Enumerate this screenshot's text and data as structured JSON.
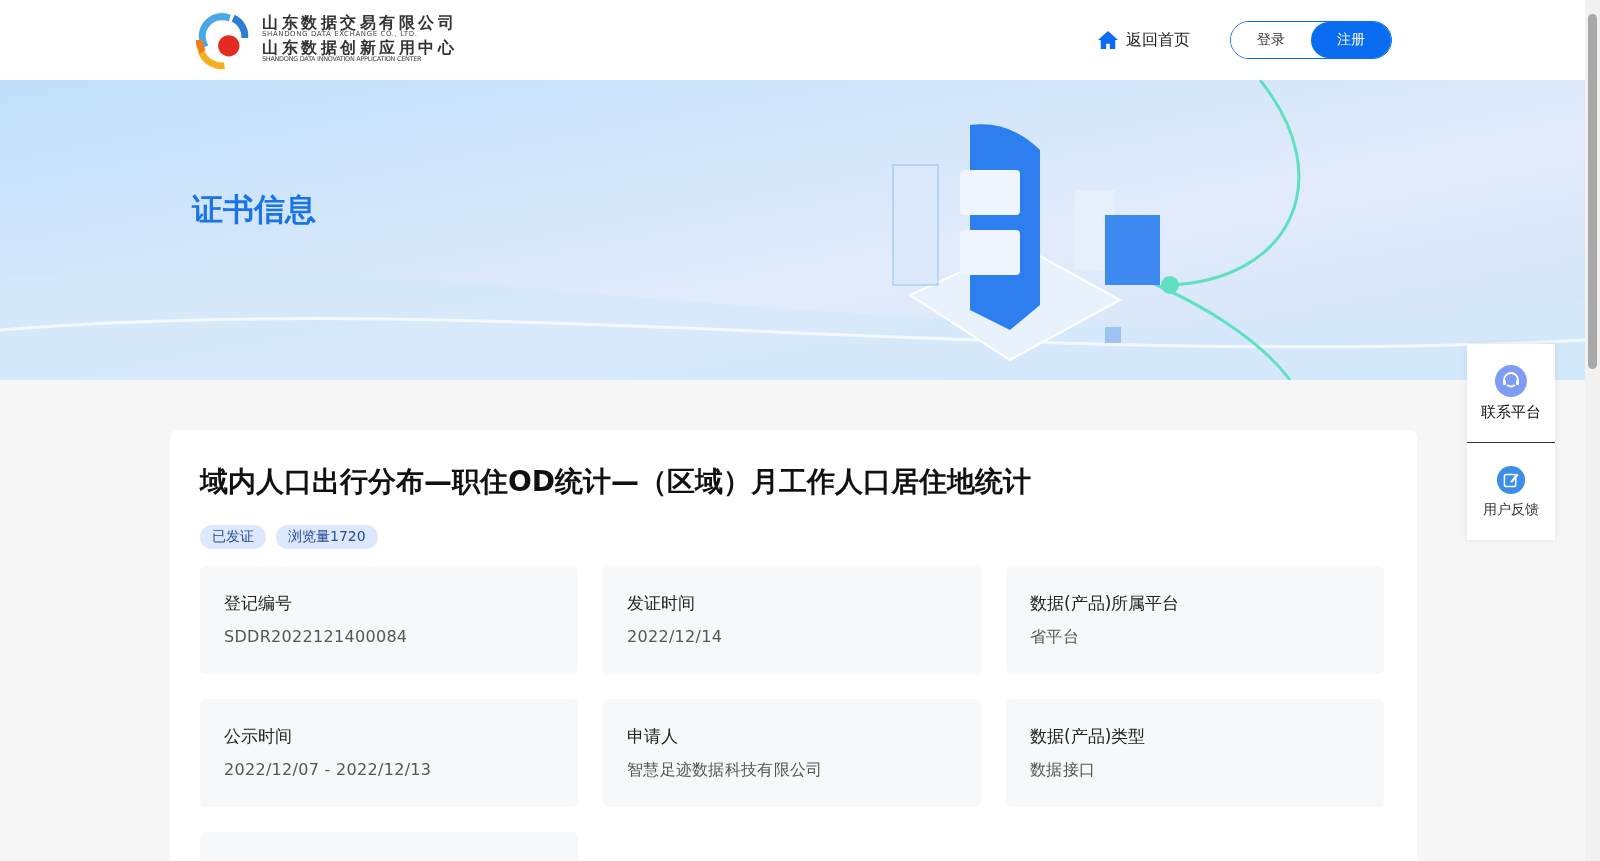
{
  "header": {
    "logo": {
      "company_cn": "山东数据交易有限公司",
      "company_en": "SHANDONG DATA EXCHANGE CO., LTD.",
      "center_cn": "山东数据创新应用中心",
      "center_en": "SHANDONG DATA INNOVATION APPLICATION CENTER"
    },
    "home_link": "返回首页",
    "login": "登录",
    "register": "注册"
  },
  "banner": {
    "title": "证书信息"
  },
  "certificate": {
    "title": "域内人口出行分布—职住OD统计—（区域）月工作人口居住地统计",
    "tags": [
      "已发证",
      "浏览量1720"
    ],
    "fields": [
      {
        "label": "登记编号",
        "value": "SDDR2022121400084"
      },
      {
        "label": "发证时间",
        "value": "2022/12/14"
      },
      {
        "label": "数据(产品)所属平台",
        "value": "省平台"
      },
      {
        "label": "公示时间",
        "value": "2022/12/07 - 2022/12/13"
      },
      {
        "label": "申请人",
        "value": "智慧足迹数据科技有限公司"
      },
      {
        "label": "数据(产品)类型",
        "value": "数据接口"
      }
    ]
  },
  "side_panel": [
    {
      "kind": "contact",
      "label": "联系平台"
    },
    {
      "kind": "feedback",
      "label": "用户反馈"
    }
  ]
}
